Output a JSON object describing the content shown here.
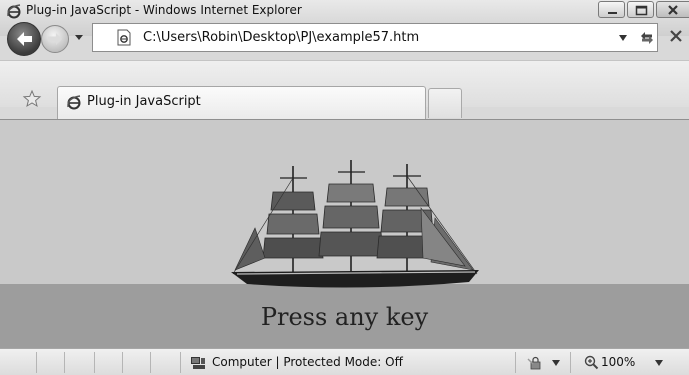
{
  "window": {
    "title": "Plug-in JavaScript - Windows Internet Explorer"
  },
  "address_bar": {
    "url": "C:\\Users\\Robin\\Desktop\\PJ\\example57.htm"
  },
  "tabs": [
    {
      "label": "Plug-in JavaScript",
      "active": true
    }
  ],
  "content": {
    "prompt_text": "Press any key",
    "sky_color": "#c9c9c9",
    "sea_color": "#9d9d9d"
  },
  "status_bar": {
    "zone_text": "Computer | Protected Mode: Off",
    "zoom": "100%"
  },
  "icons": {
    "title": "ie-logo-icon",
    "back": "back-arrow-icon",
    "forward": "forward-arrow-icon",
    "page": "page-icon",
    "refresh": "refresh-icon",
    "stop": "stop-icon",
    "favorites": "favorites-star-icon",
    "computer": "computer-icon",
    "security": "security-icon",
    "zoom": "zoom-icon"
  }
}
